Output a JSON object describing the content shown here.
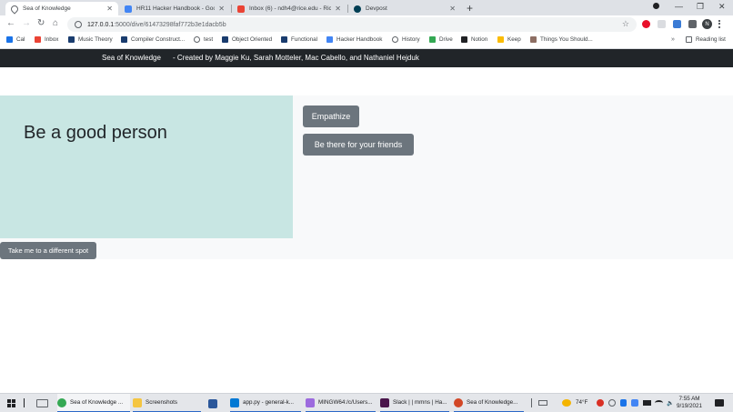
{
  "browser": {
    "tabs": [
      {
        "title": "Sea of Knowledge",
        "active": true,
        "icon": "drop-icon",
        "color": "#5f6368"
      },
      {
        "title": "HR11 Hacker Handbook - Googl",
        "active": false,
        "icon": "docs-icon",
        "color": "#4285f4"
      },
      {
        "title": "Inbox (6) - ndh4@rice.edu - Rice",
        "active": false,
        "icon": "gmail-icon",
        "color": "#ea4335"
      },
      {
        "title": "Devpost",
        "active": false,
        "icon": "devpost-icon",
        "color": "#003e54"
      }
    ],
    "new_tab": "+",
    "url": {
      "host": "127.0.0.1",
      "path": ":5000/dive/61473298faf772b3e1dacb5b"
    },
    "profile_initial": "N",
    "bookmarks": [
      {
        "label": "Cal",
        "color": "#1a73e8"
      },
      {
        "label": "Inbox",
        "color": "#ea4335"
      },
      {
        "label": "Music Theory",
        "color": "#1a3c6e"
      },
      {
        "label": "Compiler Construct...",
        "color": "#1a3c6e"
      },
      {
        "label": "test",
        "color": "#5f6368"
      },
      {
        "label": "Object Oriented",
        "color": "#1a3c6e"
      },
      {
        "label": "Functional",
        "color": "#1a3c6e"
      },
      {
        "label": "Hacker Handbook",
        "color": "#4285f4"
      },
      {
        "label": "History",
        "color": "#5f6368"
      },
      {
        "label": "Drive",
        "color": "#34a853"
      },
      {
        "label": "Notion",
        "color": "#202124"
      },
      {
        "label": "Keep",
        "color": "#fbbc04"
      },
      {
        "label": "Things You Should...",
        "color": "#8d6e63"
      }
    ],
    "bookmarks_more": "»",
    "reading_list": "Reading list"
  },
  "site": {
    "brand": "Sea of Knowledge",
    "credits": "- Created by Maggie Ku, Sarah Motteler, Mac Cabello, and Nathaniel Hejduk"
  },
  "main": {
    "thought": "Be a good person",
    "actions": [
      "Empathize",
      "Be there for your friends"
    ],
    "different_spot": "Take me to a different spot"
  },
  "taskbar": {
    "apps": [
      {
        "label": "Sea of Knowledge ...",
        "icon": "chrome-icon",
        "color": "#34a853",
        "state": "active"
      },
      {
        "label": "Screenshots",
        "icon": "folder-icon",
        "color": "#f4c542",
        "state": "running"
      },
      {
        "label": "",
        "icon": "word-icon",
        "color": "#2b579a",
        "state": "idle"
      },
      {
        "label": "app.py - general-k...",
        "icon": "vscode-icon",
        "color": "#0078d4",
        "state": "running"
      },
      {
        "label": "MINGW64:/c/Users...",
        "icon": "git-bash-icon",
        "color": "#9c6ade",
        "state": "running"
      },
      {
        "label": "Slack | | mmns | Ha...",
        "icon": "slack-icon",
        "color": "#4a154b",
        "state": "running"
      },
      {
        "label": "Sea of Knowledge...",
        "icon": "powerpoint-icon",
        "color": "#d24726",
        "state": "running"
      }
    ],
    "weather": "74°F",
    "time": "7:55 AM",
    "date": "9/19/2021"
  }
}
